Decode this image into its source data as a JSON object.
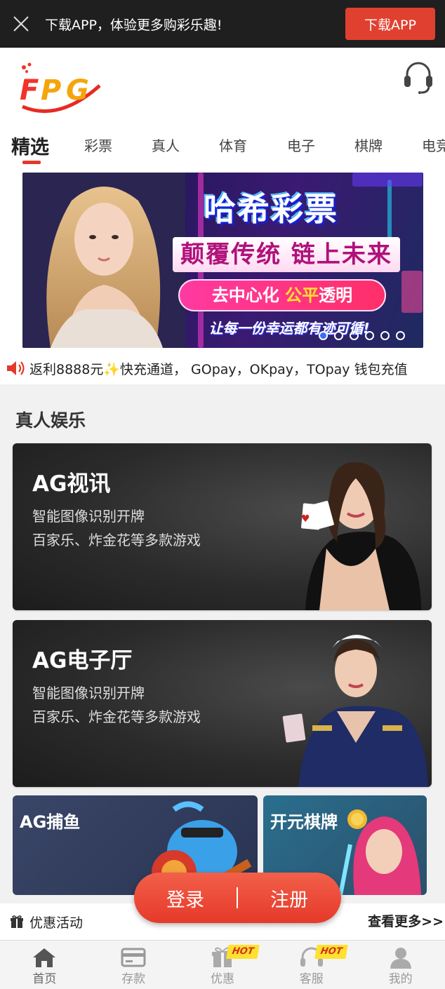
{
  "topbar": {
    "message": "下载APP，体验更多购彩乐趣!",
    "download_button": "下载APP"
  },
  "header": {
    "logo_text": "FPG",
    "support_icon": "headset-icon"
  },
  "tabs": [
    "精选",
    "彩票",
    "真人",
    "体育",
    "电子",
    "棋牌",
    "电竞"
  ],
  "banner": {
    "title": "哈希彩票",
    "subtitle": "颠覆传统 链上未来",
    "pill_left": "去中心化 ",
    "pill_right": "公平",
    "pill_end": "透明",
    "line": "让每一份幸运都有迹可循!",
    "active_dot": 0,
    "dot_count": 6
  },
  "marquee": {
    "text": "返利8888元✨快充通道， GOpay，OKpay，TOpay 钱包充值"
  },
  "section": {
    "title": "真人娱乐",
    "cards": [
      {
        "title": "AG视讯",
        "line1": "智能图像识别开牌",
        "line2": "百家乐、炸金花等多款游戏"
      },
      {
        "title": "AG电子厅",
        "line1": "智能图像识别开牌",
        "line2": "百家乐、炸金花等多款游戏"
      }
    ],
    "small_cards": [
      {
        "title": "AG捕鱼"
      },
      {
        "title": "开元棋牌"
      }
    ]
  },
  "promo": {
    "label": "优惠活动",
    "more": "查看更多>>"
  },
  "auth": {
    "login": "登录",
    "register": "注册"
  },
  "bottom_nav": [
    {
      "label": "首页",
      "icon": "home-icon",
      "hot": ""
    },
    {
      "label": "存款",
      "icon": "card-icon",
      "hot": ""
    },
    {
      "label": "优惠",
      "icon": "gift-icon",
      "hot": "HOT"
    },
    {
      "label": "客服",
      "icon": "headset-icon",
      "hot": "HOT"
    },
    {
      "label": "我的",
      "icon": "user-icon",
      "hot": ""
    }
  ],
  "colors": {
    "accent": "#e0402f",
    "topbar_bg": "#1f1f1f",
    "hot_badge": "#ffe12e"
  }
}
